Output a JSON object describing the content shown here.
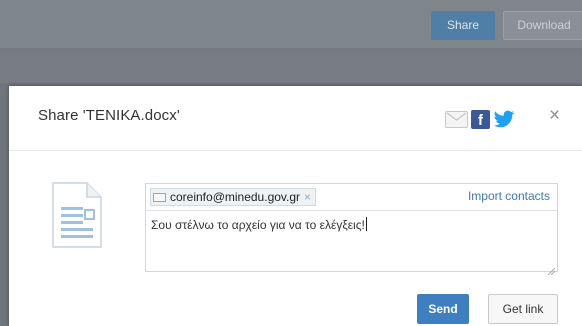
{
  "topbar": {
    "share_label": "Share",
    "download_label": "Download"
  },
  "dialog": {
    "title": "Share 'TENIKA.docx'",
    "social_icons": [
      "mail-icon",
      "facebook-icon",
      "twitter-icon"
    ],
    "close_icon": "×",
    "file_icon": "document-icon",
    "recipient": {
      "email": "coreinfo@minedu.gov.gr",
      "remove_icon": "×"
    },
    "import_contacts_label": "Import contacts",
    "message": "Σου στέλνω το αρχείο για να το ελέγξεις!",
    "send_label": "Send",
    "get_link_label": "Get link"
  },
  "colors": {
    "accent": "#3e7fc1",
    "facebook": "#3b5998",
    "twitter": "#1da1f2",
    "link": "#3e7ab8"
  }
}
